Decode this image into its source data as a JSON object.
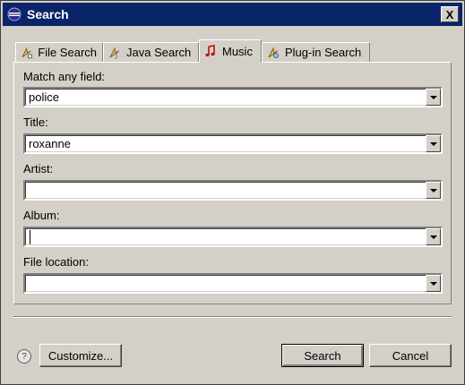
{
  "window": {
    "title": "Search",
    "close_label": "X"
  },
  "tabs": [
    {
      "label": "File Search",
      "icon": "file-search-icon",
      "active": false
    },
    {
      "label": "Java Search",
      "icon": "java-search-icon",
      "active": false
    },
    {
      "label": "Music",
      "icon": "music-note-icon",
      "active": true
    },
    {
      "label": "Plug-in Search",
      "icon": "plugin-search-icon",
      "active": false
    }
  ],
  "fields": {
    "match_any": {
      "label": "Match any field:",
      "value": "police"
    },
    "title": {
      "label": "Title:",
      "value": "roxanne"
    },
    "artist": {
      "label": "Artist:",
      "value": ""
    },
    "album": {
      "label": "Album:",
      "value": ""
    },
    "file_location": {
      "label": "File location:",
      "value": ""
    }
  },
  "buttons": {
    "help": "?",
    "customize": "Customize...",
    "search": "Search",
    "cancel": "Cancel"
  },
  "colors": {
    "titlebar": "#0a246a",
    "dialog_bg": "#d4d0c8",
    "music_icon": "#c00000"
  }
}
